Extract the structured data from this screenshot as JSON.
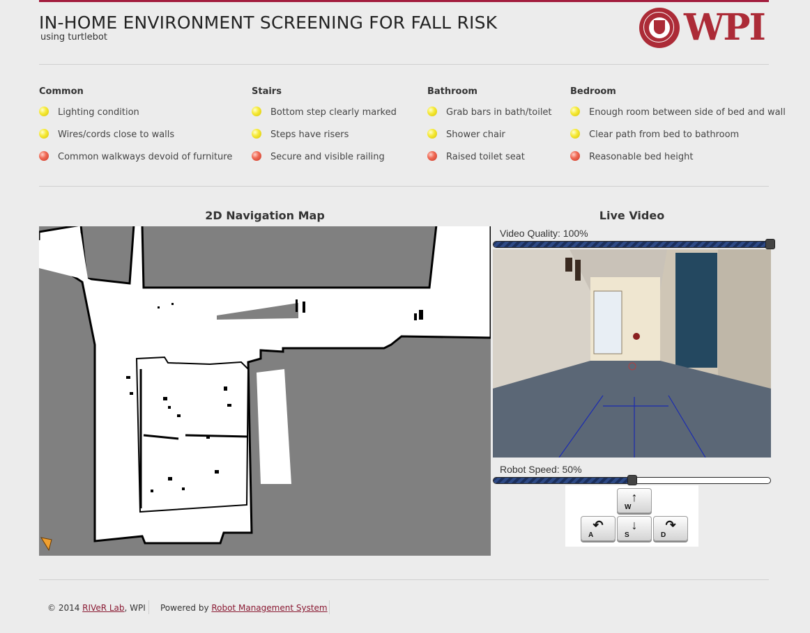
{
  "header": {
    "title": "IN-HOME ENVIRONMENT SCREENING FOR FALL RISK",
    "subtitle": "using turtlebot",
    "logo_text": "WPI",
    "brand_color": "#a31d3e"
  },
  "checklist": [
    {
      "heading": "Common",
      "items": [
        {
          "label": "Lighting condition",
          "status": "yellow"
        },
        {
          "label": "Wires/cords close to walls",
          "status": "yellow"
        },
        {
          "label": "Common walkways devoid of furniture",
          "status": "red"
        }
      ]
    },
    {
      "heading": "Stairs",
      "items": [
        {
          "label": "Bottom step clearly marked",
          "status": "yellow"
        },
        {
          "label": "Steps have risers",
          "status": "yellow"
        },
        {
          "label": "Secure and visible railing",
          "status": "red"
        }
      ]
    },
    {
      "heading": "Bathroom",
      "items": [
        {
          "label": "Grab bars in bath/toilet",
          "status": "yellow"
        },
        {
          "label": "Shower chair",
          "status": "yellow"
        },
        {
          "label": "Raised toilet seat",
          "status": "red"
        }
      ]
    },
    {
      "heading": "Bedroom",
      "items": [
        {
          "label": "Enough room between side of bed and wall",
          "status": "yellow"
        },
        {
          "label": "Clear path from bed to bathroom",
          "status": "yellow"
        },
        {
          "label": "Reasonable bed height",
          "status": "red"
        }
      ]
    }
  ],
  "map": {
    "title": "2D Navigation Map"
  },
  "video": {
    "title": "Live Video",
    "quality_label": "Video Quality: 100%",
    "quality_value": 100,
    "speed_label": "Robot Speed: 50%",
    "speed_value": 50
  },
  "keys": {
    "forward": {
      "arrow": "↑",
      "letter": "W"
    },
    "left": {
      "arrow": "↶",
      "letter": "A"
    },
    "back": {
      "arrow": "↓",
      "letter": "S"
    },
    "right": {
      "arrow": "↷",
      "letter": "D"
    }
  },
  "footer": {
    "copyright_prefix": "© 2014 ",
    "lab_link": "RIVeR Lab",
    "copyright_suffix": ", WPI",
    "powered_prefix": "Powered by ",
    "rms_link": "Robot Management System"
  }
}
